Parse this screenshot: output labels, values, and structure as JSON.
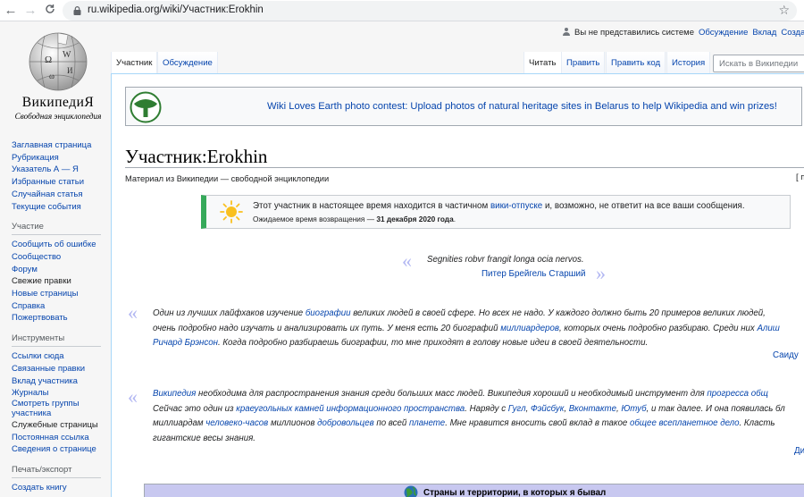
{
  "browser": {
    "url": "ru.wikipedia.org/wiki/Участник:Erokhin",
    "back_glyph": "←",
    "forward_glyph": "→",
    "reload_glyph": "C",
    "star_glyph": "☆"
  },
  "logo": {
    "wordmark": "ВикипедиЯ",
    "tagline": "Свободная энциклопедия"
  },
  "personal": {
    "not_logged": "Вы не представились системе",
    "talk": "Обсуждение",
    "contributions": "Вклад",
    "create": "Создать"
  },
  "tabs": {
    "user": "Участник",
    "discussion": "Обсуждение",
    "read": "Читать",
    "edit": "Править",
    "edit_code": "Править код",
    "history": "История"
  },
  "search": {
    "placeholder": "Искать в Википедии"
  },
  "sidebar": {
    "nav": [
      "Заглавная страница",
      "Рубрикация",
      "Указатель А — Я",
      "Избранные статьи",
      "Случайная статья",
      "Текущие события"
    ],
    "participation_head": "Участие",
    "participation": [
      "Сообщить об ошибке",
      "Сообщество",
      "Форум",
      "Свежие правки",
      "Новые страницы",
      "Справка",
      "Пожертвовать"
    ],
    "tools_head": "Инструменты",
    "tools": [
      "Ссылки сюда",
      "Связанные правки",
      "Вклад участника",
      "Журналы",
      "Смотреть группы",
      "участника",
      "Служебные страницы",
      "Постоянная ссылка",
      "Сведения о странице"
    ],
    "print_head": "Печать/экспорт",
    "print": [
      "Создать книгу"
    ]
  },
  "banner": {
    "text": "Wiki Loves Earth photo contest: Upload photos of natural heritage sites in Belarus to help Wikipedia and win prizes!"
  },
  "page": {
    "title": "Участник:Erokhin",
    "subtitle": "Материал из Википедии — свободной энциклопедии",
    "edit_bracket": "[ п"
  },
  "notice": {
    "l1_a": "Этот участник в настоящее время находится в частичном ",
    "l1_link": "вики-отпуске",
    "l1_b": " и, возможно, не ответит на все ваши сообщения.",
    "l2_a": "Ожидаемое время возвращения — ",
    "l2_date": "31 декабря 2020 года",
    "l2_b": "."
  },
  "quotes": {
    "open_mark": "«",
    "close_mark": "»",
    "q1_text": "Segnities robvr frangit longa ocia nervos.",
    "q1_author": "Питер Брейгель Старший",
    "q2_l1_a": "Один из лучших лайфхаков изучение ",
    "q2_l1_link": "биографии",
    "q2_l1_b": " великих людей в своей сфере. Но всех не надо. У каждого должно быть 20 примеров великих людей,",
    "q2_l2_a": "очень подробно надо изучать и анализировать их путь. У меня есть 20 биографий ",
    "q2_l2_link": "миллиардеров",
    "q2_l2_b": ", которых очень подробно разбираю. Среди них ",
    "q2_l2_link2": "Алиш",
    "q2_l3_link": "Ричард Брэнсон",
    "q2_l3_b": ". Когда подробно разбираешь биографии, то мне приходят в голову новые идеи в своей деятельности.",
    "q2_author": "Саиду",
    "q3_l1_link": "Википедия",
    "q3_l1_b": " необходима для распространения знания среди больших масс людей. Википедия хороший и необходимый инструмент для ",
    "q3_l1_link2": "прогресса общ",
    "q3_l2_a": "Сейчас это один из ",
    "q3_l2_link": "краеугольных камней информационного пространства",
    "q3_l2_b": ". Наряду с ",
    "q3_l2_g": "Гугл",
    "q3_l2_f": "Фэйсбук",
    "q3_l2_v": "Вконтакте",
    "q3_l2_y": "Ютуб",
    "q3_l2_c": ", и так далее. И она появилась бл",
    "q3_l3_a": "миллиардам ",
    "q3_l3_link": "человеко-часов",
    "q3_l3_b": " миллионов ",
    "q3_l3_link2": "добровольцев",
    "q3_l3_c": " по всей ",
    "q3_l3_link3": "планете",
    "q3_l3_d": ". Мне нравится вносить свой вклад в такое ",
    "q3_l3_link4": "общее всепланетное дело",
    "q3_l3_e": ". Класть",
    "q3_l4": "гигантские весы знания.",
    "q3_author": "Ди"
  },
  "countries": {
    "title": "Страны и территории, в которых я бывал"
  },
  "colors": {
    "link": "#0645ad",
    "quote_mark": "#b2b7f2",
    "notice_accent": "#36a95a",
    "countries_bg": "#c8c8f0"
  }
}
